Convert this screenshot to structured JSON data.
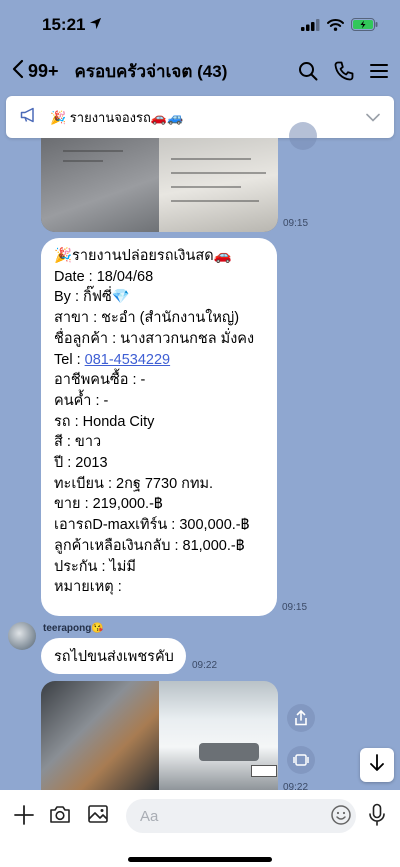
{
  "status": {
    "time": "15:21"
  },
  "header": {
    "back_count": "99+",
    "title": "ครอบครัวจ่าเจต (43)"
  },
  "announcement": {
    "text": "🎉 รายงานจองรถ🚗🚙"
  },
  "messages": {
    "img1_time": "09:15",
    "report_lines": [
      "🎉รายงานปล่อยรถเงินสด🚗",
      "Date : 18/04/68",
      "By : กิ๊ฟซี่💎",
      "สาขา : ชะอำ (สำนักงานใหญ่)",
      "ชื่อลูกค้า : นางสาวกนกชล มั่งคง",
      "Tel : ",
      "อาชีพคนซื้อ : -",
      "คนค้ำ : -",
      "รถ : Honda City",
      "สี : ขาว",
      "ปี : 2013",
      "ทะเบียน : 2กฐ 7730 กทม.",
      "ขาย : 219,000.-฿",
      "เอารถD-maxเทิร์น : 300,000.-฿",
      "ลูกค้าเหลือเงินกลับ : 81,000.-฿",
      "ประกัน : ไม่มี",
      "หมายเหตุ :"
    ],
    "tel_link": "081-4534229",
    "report_time": "09:15",
    "sender_name": "teerapong😘",
    "reply_text": "รถไปขนส่งเพชรคับ",
    "reply_time": "09:22",
    "img2_time": "09:22"
  },
  "input": {
    "placeholder": "Aa"
  },
  "colors": {
    "chat_bg": "#8fa7d0",
    "link": "#3f5fd4",
    "bubble": "#ffffff"
  }
}
